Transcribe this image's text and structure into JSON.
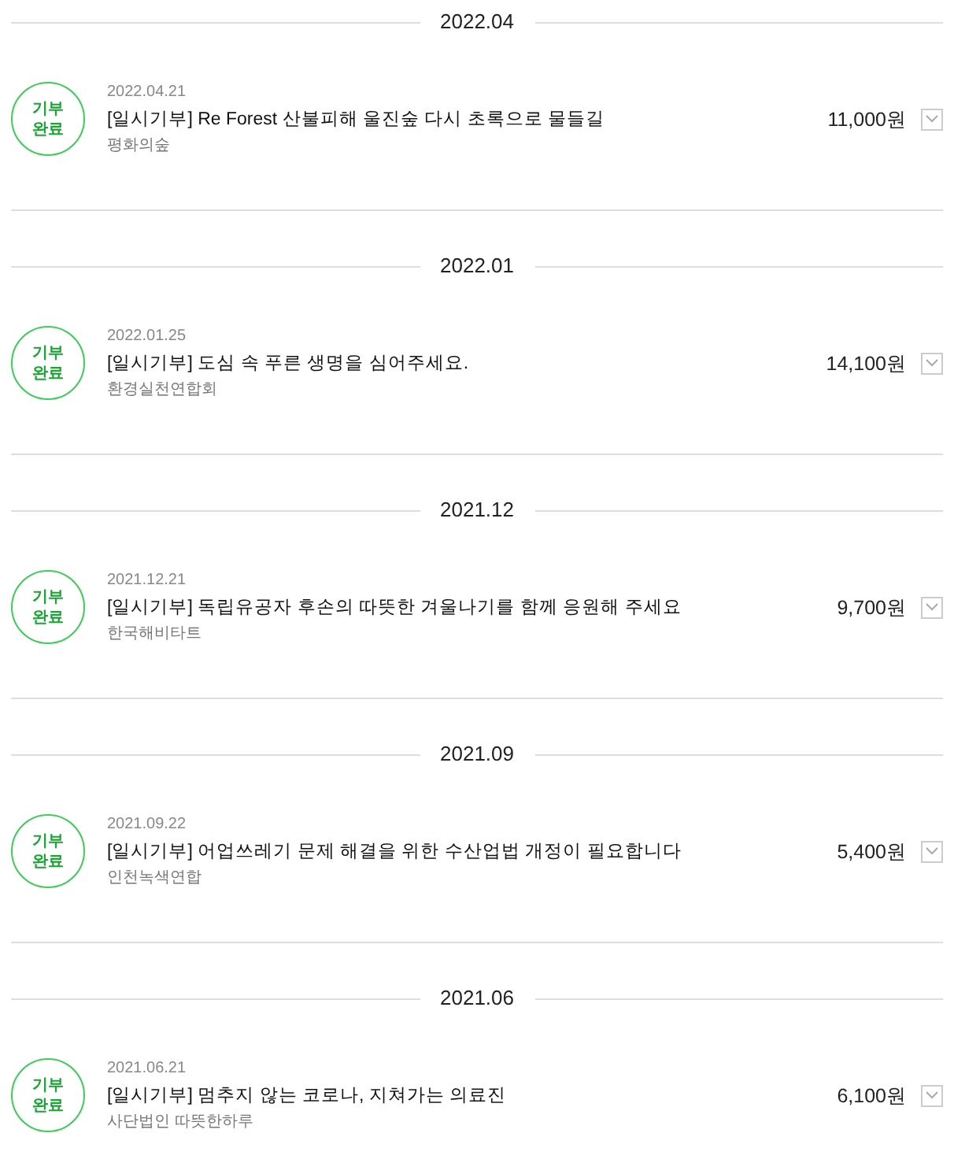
{
  "sections": [
    {
      "month": "2022.04",
      "donations": [
        {
          "status": "기부 완료",
          "date": "2022.04.21",
          "title": "[일시기부] Re Forest 산불피해 울진숲 다시 초록으로 물들길",
          "organization": "평화의숲",
          "amount": "11,000원",
          "expanded": false
        }
      ]
    },
    {
      "month": "2022.01",
      "donations": [
        {
          "status": "기부 완료",
          "date": "2022.01.25",
          "title": "[일시기부] 도심 속 푸른 생명을 심어주세요.",
          "organization": "환경실천연합회",
          "amount": "14,100원",
          "expanded": false
        }
      ]
    },
    {
      "month": "2021.12",
      "donations": [
        {
          "status": "기부 완료",
          "date": "2021.12.21",
          "title": "[일시기부] 독립유공자 후손의 따뜻한 겨울나기를 함께 응원해 주세요",
          "organization": "한국해비타트",
          "amount": "9,700원",
          "expanded": false
        }
      ]
    },
    {
      "month": "2021.09",
      "donations": [
        {
          "status": "기부 완료",
          "date": "2021.09.22",
          "title": "[일시기부] 어업쓰레기 문제 해결을 위한 수산업법 개정이 필요합니다",
          "organization": "인천녹색연합",
          "amount": "5,400원",
          "expanded": false
        }
      ]
    },
    {
      "month": "2021.06",
      "donations": [
        {
          "status": "기부 완료",
          "date": "2021.06.21",
          "title": "[일시기부] 멈추지 않는 코로나, 지쳐가는 의료진",
          "organization": "사단법인 따뜻한하루",
          "amount": "6,100원",
          "expanded": false
        }
      ]
    }
  ]
}
